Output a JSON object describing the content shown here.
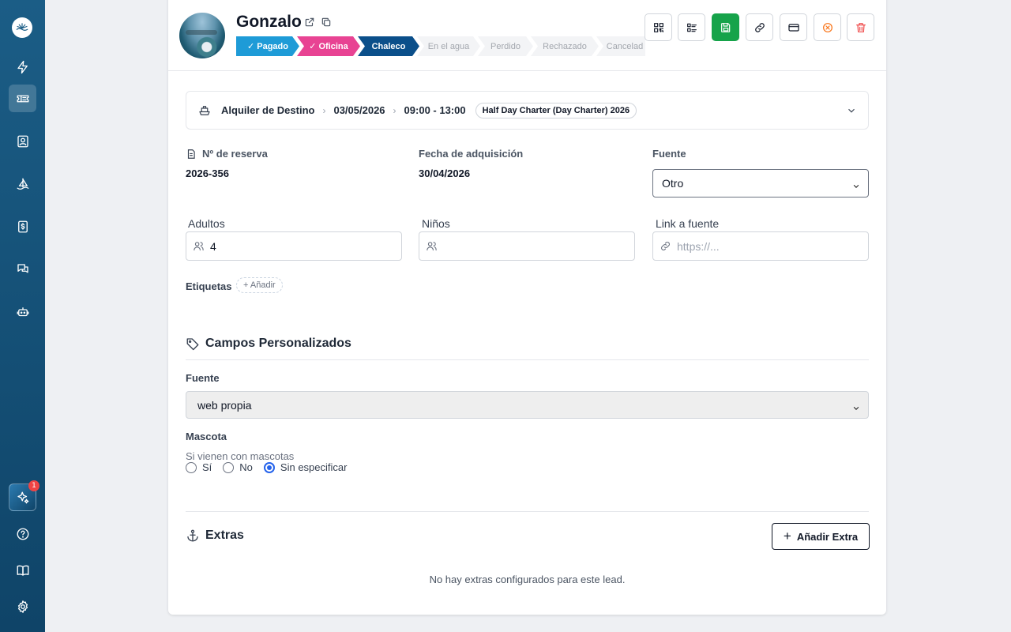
{
  "sidebar": {
    "ai_badge": "1",
    "colors": {
      "bg_top": "#1b5d86",
      "bg_bottom": "#0f4468"
    }
  },
  "header": {
    "name": "Gonzalo",
    "stages": [
      {
        "label": "Pagado",
        "done": true,
        "color": "#1e9bd7"
      },
      {
        "label": "Oficina",
        "done": true,
        "color": "#e84393"
      },
      {
        "label": "Chaleco",
        "done": false,
        "current": true,
        "color": "#0b4f8a"
      },
      {
        "label": "En el agua"
      },
      {
        "label": "Perdido"
      },
      {
        "label": "Rechazado"
      },
      {
        "label": "Cancelad"
      }
    ]
  },
  "trip": {
    "product": "Alquiler de Destino",
    "date": "03/05/2026",
    "time": "09:00 - 13:00",
    "rate": "Half Day Charter (Day Charter) 2026"
  },
  "booking": {
    "reservation_label": "Nº de reserva",
    "reservation_value": "2026-356",
    "acquired_label": "Fecha de adquisición",
    "acquired_value": "30/04/2026",
    "source_label": "Fuente",
    "source_value": "Otro",
    "adults_label": "Adultos",
    "adults_value": "4",
    "children_label": "Niños",
    "children_value": "",
    "source_link_label": "Link a fuente",
    "source_link_placeholder": "https://...",
    "tags_label": "Etiquetas",
    "tags_add": "+ Añadir"
  },
  "custom_fields": {
    "title": "Campos Personalizados",
    "source_label": "Fuente",
    "source_value": "web propia",
    "pet_label": "Mascota",
    "pet_help": "Si vienen con mascotas",
    "pet_options": [
      "Sí",
      "No",
      "Sin especificar"
    ],
    "pet_selected": "Sin especificar"
  },
  "extras": {
    "title": "Extras",
    "add_label": "Añadir Extra",
    "empty": "No hay extras configurados para este lead."
  }
}
